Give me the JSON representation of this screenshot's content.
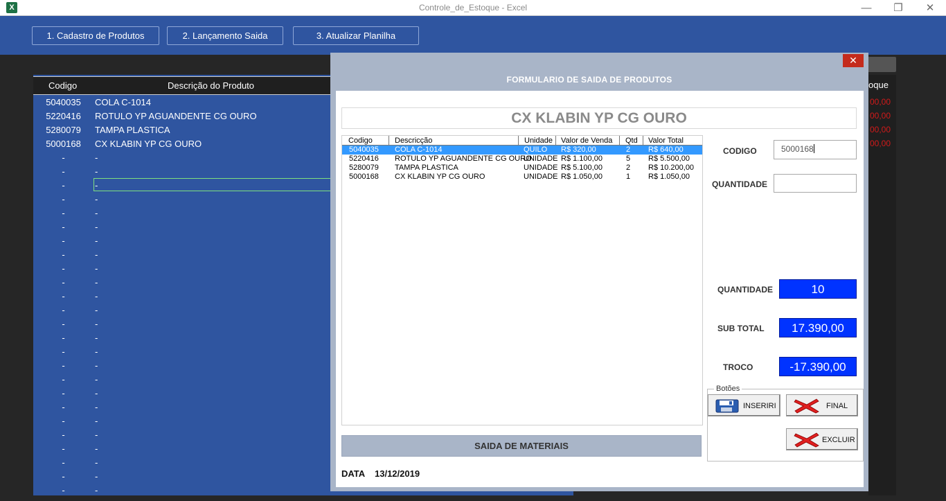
{
  "window": {
    "title": "Controle_de_Estoque - Excel",
    "app_icon_letter": "X",
    "minimize": "—",
    "restore": "❐",
    "close": "✕"
  },
  "macro_buttons": [
    "1. Cadastro de Produtos",
    "2. Lançamento Saida",
    "3. Atualizar Planilha"
  ],
  "sheet": {
    "headers": {
      "codigo": "Codigo",
      "descricao": "Descrição do Produto",
      "estoque_partial": "oque"
    },
    "rows": [
      {
        "codigo": "5040035",
        "descricao": "COLA C-1014"
      },
      {
        "codigo": "5220416",
        "descricao": "ROTULO YP AGUANDENTE CG OURO"
      },
      {
        "codigo": "5280079",
        "descricao": "TAMPA PLASTICA"
      },
      {
        "codigo": "5000168",
        "descricao": "CX  KLABIN YP CG OURO"
      }
    ],
    "empty_placeholder": "-",
    "red_values": [
      "00,00",
      "00,00",
      "00,00",
      "00,00"
    ]
  },
  "form": {
    "close": "✕",
    "caption": "FORMULARIO DE SAIDA DE PRODUTOS",
    "product_title": "CX  KLABIN YP CG OURO",
    "list": {
      "headers": [
        "Codigo",
        "Descricção",
        "Unidade",
        "Valor de Venda",
        "Qtd",
        "Valor Total"
      ],
      "rows": [
        [
          "5040035",
          "COLA C-1014",
          "QUILO",
          "R$ 320,00",
          "2",
          "R$ 640,00"
        ],
        [
          "5220416",
          "ROTULO YP AGUANDENTE CG OURO",
          "UNIDADE",
          "R$ 1.100,00",
          "5",
          "R$ 5.500,00"
        ],
        [
          "5280079",
          "TAMPA PLASTICA",
          "UNIDADE",
          "R$ 5.100,00",
          "2",
          "R$ 10.200,00"
        ],
        [
          "5000168",
          "CX  KLABIN YP CG OURO",
          "UNIDADE",
          "R$ 1.050,00",
          "1",
          "R$ 1.050,00"
        ]
      ]
    },
    "codigo_label": "CODIGO",
    "codigo_value": "5000168",
    "quantidade_label": "QUANTIDADE",
    "quantidade_value": "",
    "totals": {
      "quantidade_label": "QUANTIDADE",
      "quantidade_value": "10",
      "subtotal_label": "SUB TOTAL",
      "subtotal_value": "17.390,00",
      "troco_label": "TROCO",
      "troco_value": "-17.390,00"
    },
    "buttons_frame_label": "Botões",
    "btn_inserir": "INSERIRI",
    "btn_final": "FINAL",
    "btn_excluir": "EXCLUIR",
    "saida_label": "SAIDA DE MATERIAIS",
    "data_label": "DATA",
    "data_value": "13/12/2019"
  },
  "colors": {
    "ribbon_blue": "#2f55a0",
    "value_box_blue": "#0033ff",
    "selection_blue": "#3399ff",
    "close_red": "#c42b1c"
  }
}
